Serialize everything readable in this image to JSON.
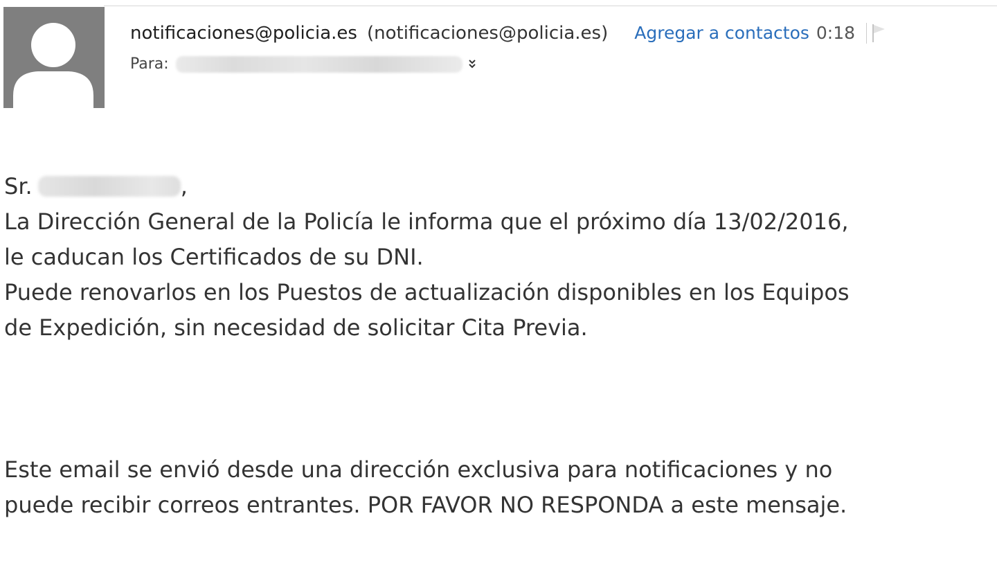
{
  "header": {
    "sender_name": "notificaciones@policia.es",
    "sender_address": "(notificaciones@policia.es)",
    "add_contact_label": "Agregar a contactos",
    "time": "0:18",
    "to_label": "Para:",
    "to_value": "",
    "expand_icon": "double-chevron-down-icon",
    "flag_icon": "flag-icon"
  },
  "message": {
    "salutation_prefix": "Sr.",
    "salutation_suffix": ",",
    "lines": [
      "La Dirección General de la Policía le informa que el próximo día 13/02/2016,",
      "le caducan los Certificados de su DNI.",
      "Puede renovarlos en los Puestos de actualización disponibles en los Equipos",
      "de Expedición, sin necesidad de solicitar Cita Previa."
    ],
    "footer_lines": [
      "Este email se envió desde una dirección exclusiva para notificaciones y no",
      "puede recibir correos entrantes. POR FAVOR NO RESPONDA a este mensaje."
    ]
  },
  "colors": {
    "link": "#2a6ebb",
    "avatar_bg": "#7f7f7f",
    "text": "#333333"
  }
}
